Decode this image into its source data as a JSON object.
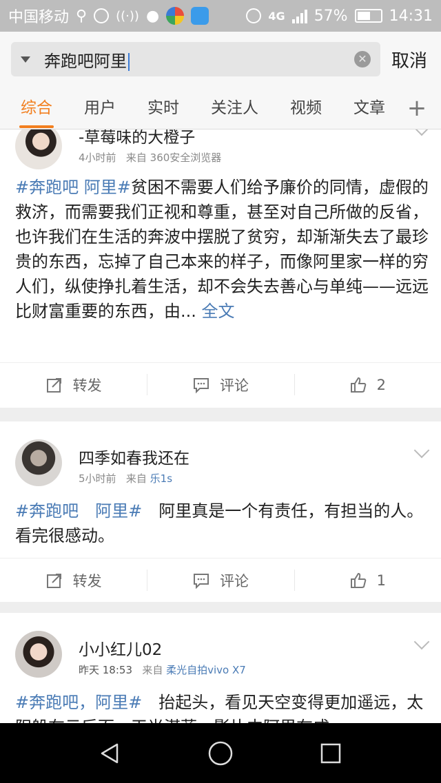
{
  "status_bar": {
    "carrier": "中国移动",
    "network": "4G",
    "battery": "57%",
    "battery_level": 0.57,
    "time": "14:31"
  },
  "search": {
    "query": "奔跑吧阿里",
    "cancel_label": "取消"
  },
  "tabs": [
    {
      "label": "综合",
      "active": true
    },
    {
      "label": "用户",
      "active": false
    },
    {
      "label": "实时",
      "active": false
    },
    {
      "label": "关注人",
      "active": false
    },
    {
      "label": "视频",
      "active": false
    },
    {
      "label": "文章",
      "active": false
    }
  ],
  "posts": [
    {
      "username": "-草莓味的大橙子",
      "time": "4小时前",
      "from_label": "来自",
      "source": "360安全浏览器",
      "hashtag": "#奔跑吧 阿里#",
      "text": "贫困不需要人们给予廉价的同情，虚假的救济，而需要我们正视和尊重，甚至对自己所做的反省，也许我们在生活的奔波中摆脱了贫穷，却渐渐失去了最珍贵的东西，忘掉了自己本来的样子，而像阿里家一样的穷人们，纵使挣扎着生活，却不会失去善心与单纯——远远比财富重要的东西，由...",
      "more": "全文",
      "repost_label": "转发",
      "comment_label": "评论",
      "likes": "2"
    },
    {
      "username": "四季如春我还在",
      "time": "5小时前",
      "from_label": "来自",
      "source": "乐1s",
      "hashtag": "#奔跑吧　阿里#",
      "text": "　阿里真是一个有责任，有担当的人。看完很感动。",
      "repost_label": "转发",
      "comment_label": "评论",
      "likes": "1"
    },
    {
      "username": "小小红儿02",
      "time": "昨天 18:53",
      "from_label": "来自",
      "source": "柔光自拍vivo X7",
      "hashtag": "#奔跑吧，阿里#",
      "text": "　抬起头，看见天空变得更加遥远，太阳躲在云后面，天光湛蓝，影片中阿里在成"
    }
  ]
}
